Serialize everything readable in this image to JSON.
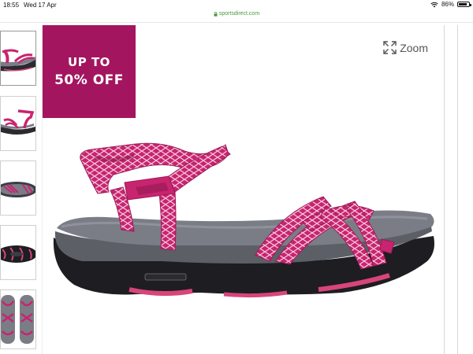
{
  "status_bar": {
    "time": "18:55",
    "date": "Wed 17 Apr",
    "battery_text": "86%",
    "battery_level": 0.86,
    "wifi_icon": "wifi-icon"
  },
  "browser": {
    "url": "sportsdirect.com",
    "lock_icon": "lock-icon"
  },
  "gallery": {
    "thumbnails": [
      {
        "view": "side",
        "active": true
      },
      {
        "view": "angle",
        "active": false
      },
      {
        "view": "top",
        "active": false
      },
      {
        "view": "sole",
        "active": false
      },
      {
        "view": "pair",
        "active": false
      }
    ],
    "zoom_label": "Zoom",
    "zoom_icon": "expand-icon"
  },
  "promo": {
    "line1": "UP TO",
    "line2": "50% OFF",
    "color": "#a3165f"
  },
  "product": {
    "colors": {
      "strap": "#c8246f",
      "strap_pattern": "#f4c6dc",
      "footbed": "#7a7d86",
      "midsole": "#5c5f66",
      "outsole": "#1d1d22",
      "tread": "#d8457a"
    }
  }
}
